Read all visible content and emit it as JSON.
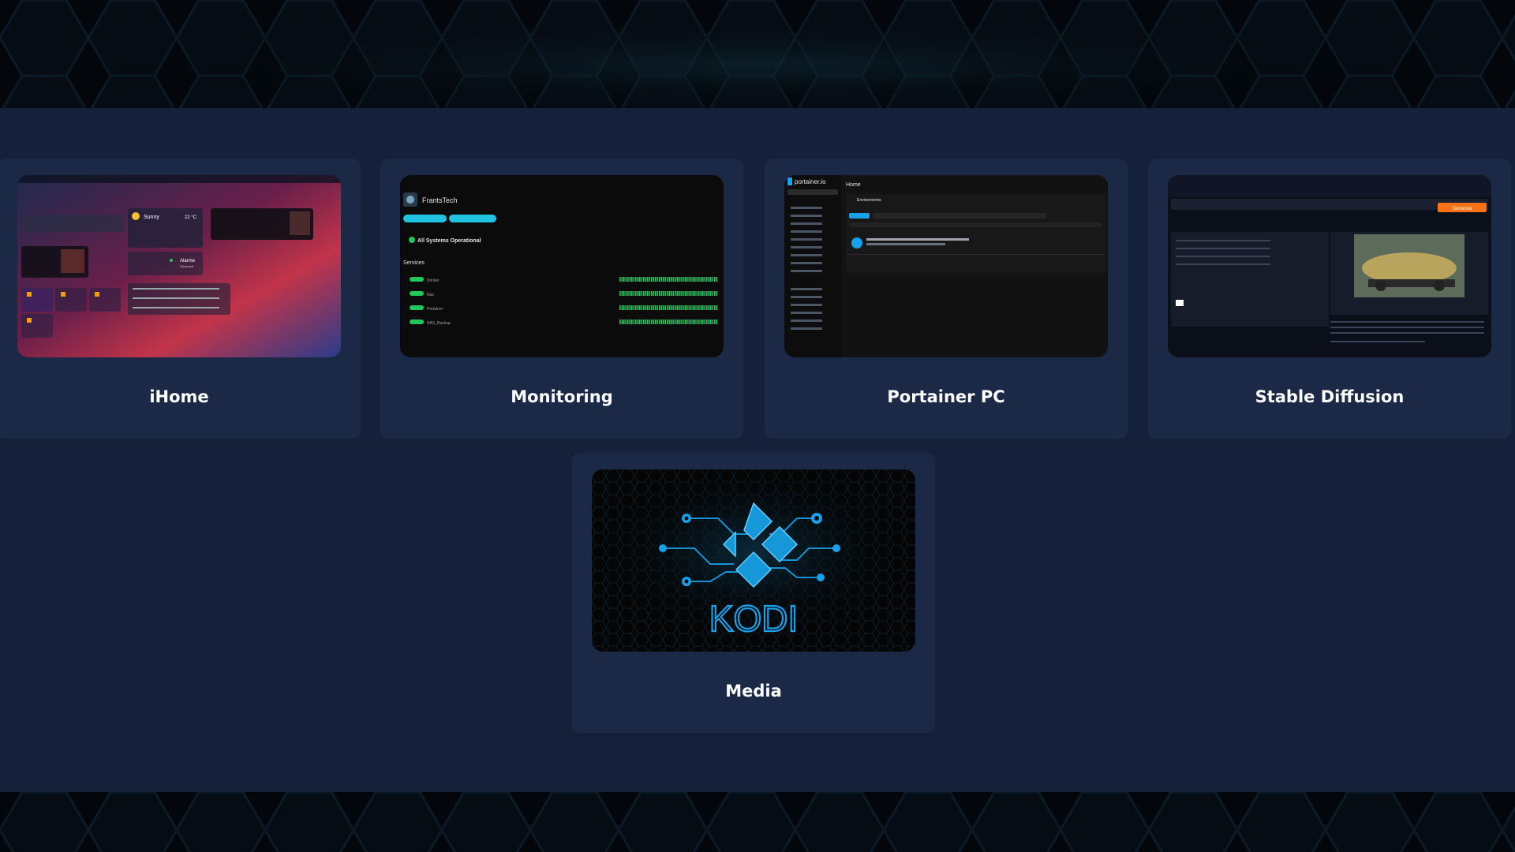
{
  "tiles": [
    {
      "label": "iHome",
      "preview": {
        "weather": "Sunny",
        "temperature": "22 °C",
        "alarm_label": "Alarme",
        "alarm_state": "Disarmed"
      }
    },
    {
      "label": "Monitoring",
      "preview": {
        "brand": "FrantsTech",
        "status": "All Systems Operational",
        "services_heading": "Services",
        "services": [
          "Docker",
          "Nas",
          "Portainer",
          "NAS_Backup"
        ],
        "status_color": "#22c55e"
      }
    },
    {
      "label": "Portainer PC",
      "preview": {
        "brand": "portainer.io",
        "page_title": "Home",
        "section": "Environments",
        "accent_color": "#1aa0e8"
      }
    },
    {
      "label": "Stable Diffusion",
      "preview": {
        "button_label": "Generate",
        "accent_color": "#f97316"
      }
    },
    {
      "label": "Media",
      "preview": {
        "logo_text": "KODI",
        "accent_color": "#1aa0e8"
      }
    }
  ],
  "colors": {
    "panel": "#15213a",
    "card": "#1b2946",
    "label": "#ffffff"
  }
}
